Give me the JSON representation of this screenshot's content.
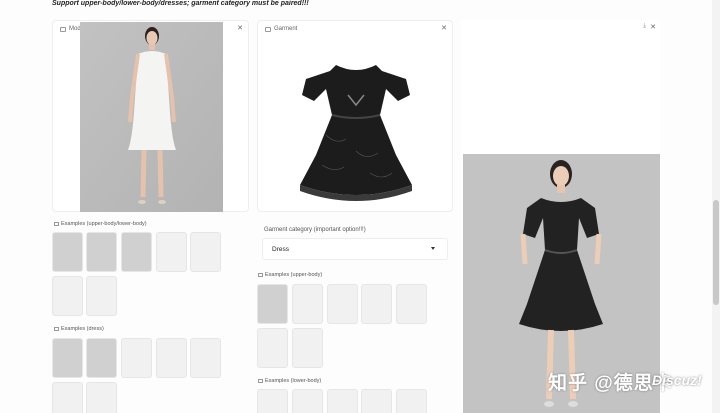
{
  "top_note": "Support upper-body/lower-body/dresses; garment category must be paired!!!",
  "model_panel": {
    "label": "Model"
  },
  "garment_panel": {
    "label": "Garment"
  },
  "garment_category": {
    "label": "Garment category (important option!!!)",
    "value": "Dress"
  },
  "model_examples": {
    "upper_lower_label": "Examples (upper-body/lower-body)",
    "dress_label": "Examples (dress)"
  },
  "garment_examples": {
    "upper_label": "Examples (upper-body)",
    "lower_label": "Examples (lower-body)"
  },
  "watermark": {
    "text": "知乎 @德思卡",
    "logo": "Discuz!"
  },
  "colors": {
    "dress_dark": "#1a1a1a",
    "bg": "#fdfdfd",
    "panel_border": "#eeeeee"
  },
  "icons": [
    "image-icon",
    "close-icon",
    "download-icon",
    "chevron-down-icon"
  ]
}
